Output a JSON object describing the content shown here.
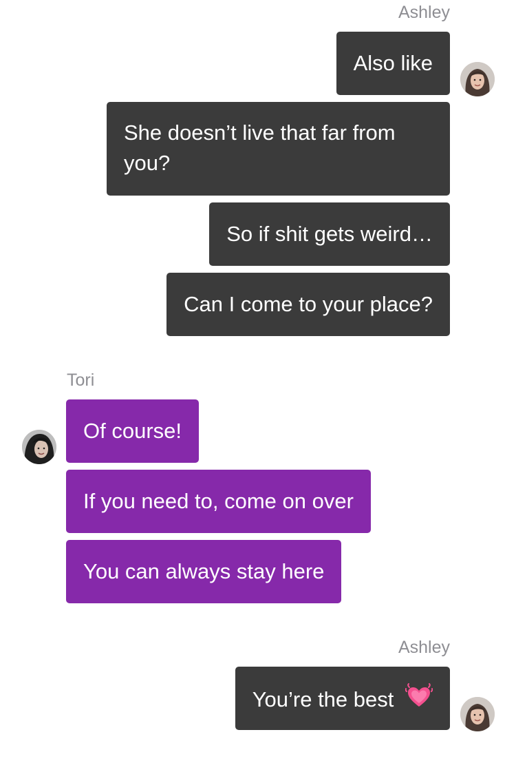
{
  "conversation": {
    "groups": [
      {
        "sender": "Ashley",
        "messages": [
          "Also like",
          "She doesn’t live that far from you?",
          "So if shit gets weird…",
          "Can I come to your place?"
        ]
      },
      {
        "sender": "Tori",
        "messages": [
          "Of course!",
          "If you need to, come on over",
          "You can always stay here"
        ]
      },
      {
        "sender": "Ashley",
        "messages": [
          "You’re the best"
        ]
      }
    ]
  },
  "colors": {
    "outgoing_bubble": "#3b3b3b",
    "incoming_bubble": "#8629aa",
    "sender_label": "#8e8e93",
    "bubble_text": "#ffffff"
  },
  "icons": {
    "last_message_emoji": "growing-heart-icon"
  }
}
